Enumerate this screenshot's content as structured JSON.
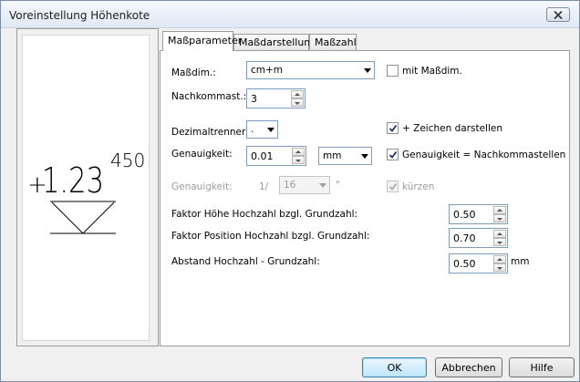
{
  "window": {
    "title": "Voreinstellung Höhenkote"
  },
  "preview": {
    "prefix": "+",
    "value": "1.23",
    "superscript": "450"
  },
  "tabs": [
    {
      "label": "Maßparameter",
      "active": true
    },
    {
      "label": "Maßdarstellung",
      "active": false
    },
    {
      "label": "Maßzahl",
      "active": false
    }
  ],
  "form": {
    "massdim": {
      "label": "Maßdim.:",
      "value": "cm+m"
    },
    "mit_massdim": {
      "label": "mit Maßdim.",
      "checked": false
    },
    "nachkommast": {
      "label": "Nachkommast.:",
      "value": "3"
    },
    "dezimaltrenner": {
      "label": "Dezimaltrenner:",
      "value": "."
    },
    "zeichen": {
      "label": "+ Zeichen darstellen",
      "checked": true
    },
    "genauigkeit": {
      "label": "Genauigkeit:",
      "value": "0.01",
      "unit": "mm"
    },
    "genauigkeit_nk": {
      "label": "Genauigkeit = Nachkommastellen",
      "checked": true
    },
    "genauigkeit2": {
      "label": "Genauigkeit:",
      "prefix": "1/",
      "value": "16",
      "suffix": "\""
    },
    "kuerzen": {
      "label": "kürzen",
      "checked": true
    },
    "faktor_hoehe": {
      "label": "Faktor Höhe Hochzahl bzgl. Grundzahl:",
      "value": "0.50"
    },
    "faktor_position": {
      "label": "Faktor Position Hochzahl bzgl. Grundzahl:",
      "value": "0.70"
    },
    "abstand": {
      "label": "Abstand Hochzahl - Grundzahl:",
      "value": "0.50",
      "unit": "mm"
    }
  },
  "buttons": {
    "ok": "OK",
    "cancel": "Abbrechen",
    "help": "Hilfe"
  }
}
